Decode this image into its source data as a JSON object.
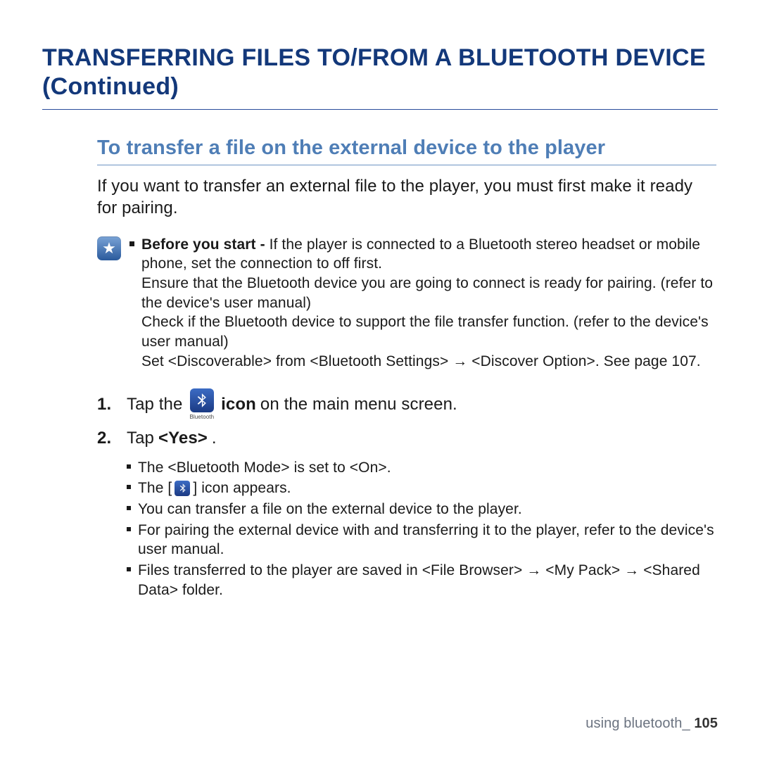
{
  "heading": "TRANSFERRING FILES TO/FROM A BLUETOOTH DEVICE (Continued)",
  "subheading": "To transfer a file on the external device to the player",
  "intro": "If you want to transfer an external file to the player, you must first make it ready for pairing.",
  "note": {
    "before_label": "Before you start - ",
    "lines": [
      "If the player is connected to a Bluetooth stereo headset or mobile phone, set the connection to off first.",
      "Ensure that the Bluetooth device you are going to connect is ready for pairing. (refer to the device's user manual)",
      "Check if the Bluetooth device to support the file transfer function. (refer to the device's user manual)",
      "Set <Discoverable> from <Bluetooth Settings> → <Discover Option>. See page 107."
    ]
  },
  "steps": {
    "s1_num": "1.",
    "s1_a": "Tap the",
    "s1_b": "icon",
    "s1_c": " on the main menu screen.",
    "bt_caption": "Bluetooth",
    "s2_num": "2.",
    "s2_a": "Tap ",
    "s2_b": "<Yes>",
    "s2_c": "."
  },
  "sub": {
    "b1": "The <Bluetooth Mode> is set to <On>.",
    "b2a": "The [",
    "b2b": "] icon appears.",
    "b3": "You can transfer a file on the external device to the player.",
    "b4": "For pairing the external device with and transferring it to the player, refer to the device's user manual.",
    "b5": "Files transferred to the player are saved in <File Browser> → <My Pack> → <Shared Data> folder."
  },
  "footer": {
    "label": "using bluetooth_ ",
    "page": "105"
  }
}
